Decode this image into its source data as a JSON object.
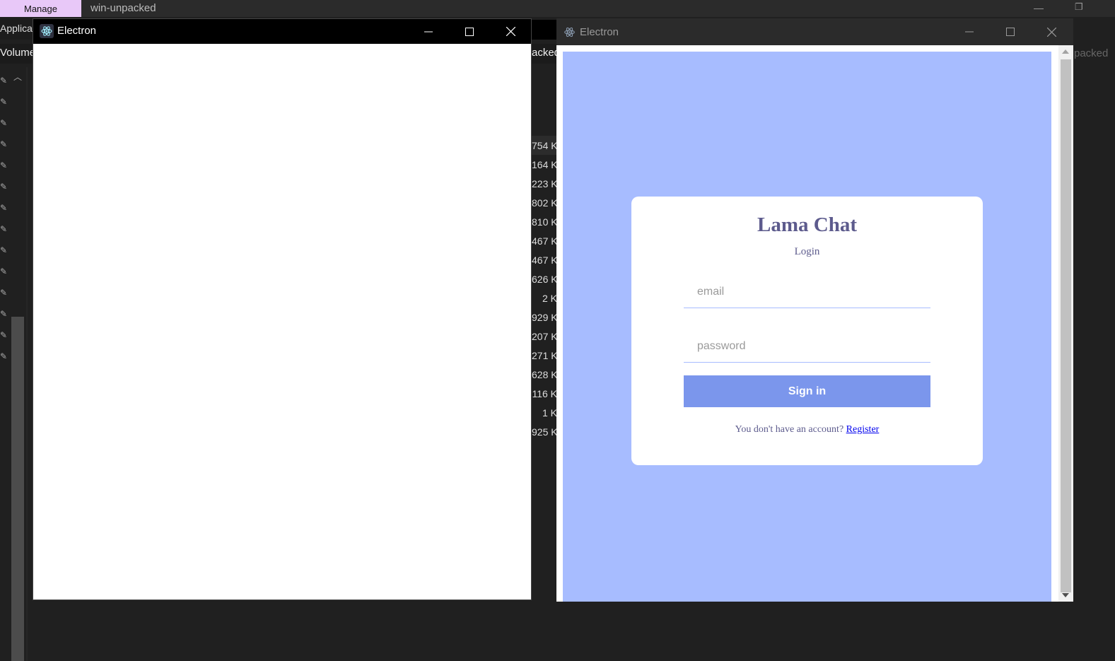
{
  "background_explorer": {
    "manage_tab": "Manage",
    "window_title": "win-unpacked",
    "ribbon_application_label": "Applicati",
    "ribbon_volume_label": "Volume",
    "mid_strip_label": "acked",
    "right_strip_label": "packed",
    "file_sizes": [
      "754 K",
      "164 K",
      "223 K",
      "802 K",
      "810 K",
      "467 K",
      "467 K",
      "626 K",
      "2 K",
      "929 K",
      "207 K",
      "271 K",
      "628 K",
      "116 K",
      "1 K",
      "925 K"
    ]
  },
  "electron_blank": {
    "title": "Electron"
  },
  "electron_login": {
    "title": "Electron",
    "app_name": "Lama Chat",
    "subtitle": "Login",
    "email_placeholder": "email",
    "password_placeholder": "password",
    "signin_label": "Sign in",
    "footer_prompt": "You don't have an account? ",
    "register_link": "Register",
    "colors": {
      "page_background": "#a7bcff",
      "button": "#7b96ec",
      "logo_text": "#5d5b8d"
    }
  }
}
